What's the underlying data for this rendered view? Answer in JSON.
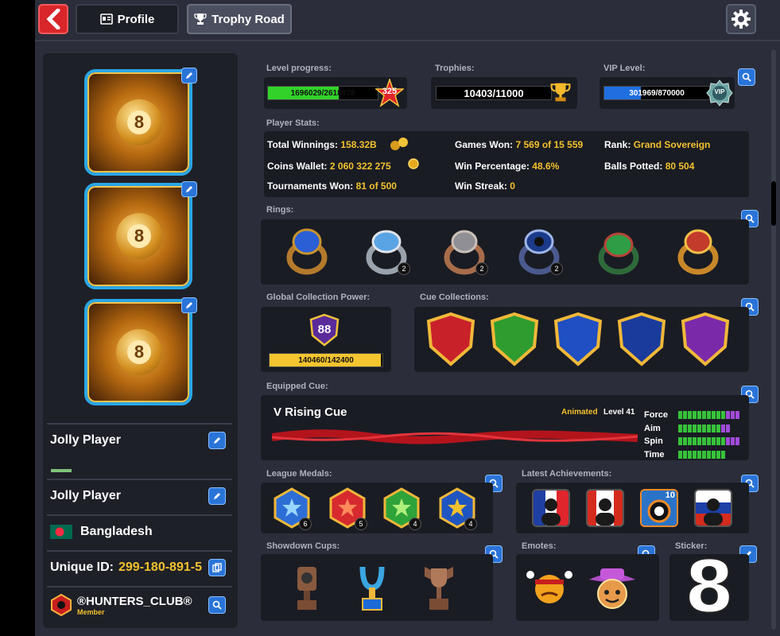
{
  "topbar": {
    "profile_tab": "Profile",
    "trophy_tab": "Trophy Road"
  },
  "left": {
    "frame_ball_number": "8",
    "player_name_1": "Jolly Player",
    "player_name_2": "Jolly Player",
    "country": "Bangladesh",
    "unique_id_label": "Unique ID:",
    "unique_id_value": "299-180-891-5",
    "club_name": "®HUNTERS_CLUB®",
    "club_role": "Member"
  },
  "level": {
    "label": "Level progress:",
    "text": "1696029/2618878",
    "progress": 0.648,
    "level": "325"
  },
  "trophies": {
    "label": "Trophies:",
    "text": "10403/11000"
  },
  "vip": {
    "label": "VIP Level:",
    "text": "301969/870000",
    "progress": 0.347,
    "badge": "VIP"
  },
  "stats": {
    "label": "Player Stats:",
    "total_winnings_label": "Total Winnings:",
    "total_winnings": "158.32B",
    "coins_wallet_label": "Coins Wallet:",
    "coins_wallet": "2 060 322 275",
    "tournaments_won_label": "Tournaments Won:",
    "tournaments_won": "81 of 500",
    "games_won_label": "Games Won:",
    "games_won": "7 569 of 15 559",
    "win_pct_label": "Win Percentage:",
    "win_pct": "48.6%",
    "win_streak_label": "Win Streak:",
    "win_streak": "0",
    "rank_label": "Rank:",
    "rank": "Grand Sovereign",
    "balls_potted_label": "Balls Potted:",
    "balls_potted": "80 504"
  },
  "rings": {
    "label": "Rings:",
    "counts": [
      "",
      "2",
      "2",
      "2",
      "",
      ""
    ]
  },
  "gcp": {
    "label": "Global Collection Power:",
    "level": "88",
    "text": "140460/142400",
    "progress": 0.986
  },
  "cues": {
    "label": "Cue Collections:"
  },
  "equipped": {
    "label": "Equipped Cue:",
    "name": "V Rising Cue",
    "animated": "Animated",
    "level": "Level 41",
    "attrs": [
      "Force",
      "Aim",
      "Spin",
      "Time"
    ],
    "green": [
      10,
      9,
      10,
      10
    ],
    "purple": [
      3,
      2,
      3,
      0
    ]
  },
  "league": {
    "label": "League Medals:",
    "counts": [
      "6",
      "5",
      "4",
      "4"
    ]
  },
  "achievements": {
    "label": "Latest Achievements:",
    "badge_number": "10"
  },
  "showdown": {
    "label": "Showdown Cups:"
  },
  "emotes": {
    "label": "Emotes:"
  },
  "sticker": {
    "label": "Sticker:",
    "value": "8"
  },
  "colors": {
    "accent_blue": "#2a74d8",
    "back_red": "#d9262a",
    "gold_text": "#f2c12e",
    "level_green": "#31d32a",
    "vip_blue": "#1f6fe0",
    "gcp_gold": "#f5c530"
  }
}
